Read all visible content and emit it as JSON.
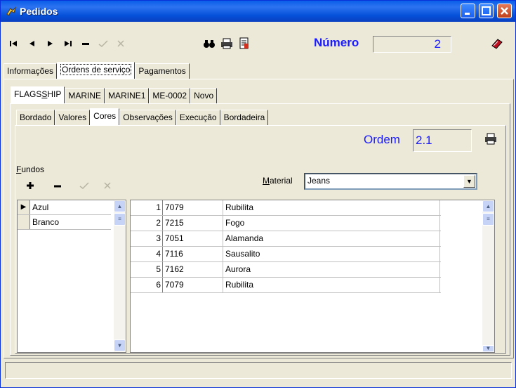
{
  "window": {
    "title": "Pedidos"
  },
  "toolbar": {
    "numero_label": "Número",
    "numero_value": "2"
  },
  "tabs_main": [
    "Informações",
    "Ordens de serviço",
    "Pagamentos"
  ],
  "tabs_orders": [
    "FLAGSSHIP",
    "MARINE",
    "MARINE1",
    "ME-0002",
    "Novo"
  ],
  "tabs_detail": [
    "Bordado",
    "Valores",
    "Cores",
    "Observações",
    "Execução",
    "Bordadeira"
  ],
  "ordem": {
    "label": "Ordem",
    "value": "2.1"
  },
  "fundos": {
    "label": "Fundos",
    "items": [
      "Azul",
      "Branco"
    ]
  },
  "material": {
    "label": "Material",
    "value": "Jeans"
  },
  "grid": {
    "rows": [
      {
        "n": "1",
        "code": "7079",
        "name": "Rubilita"
      },
      {
        "n": "2",
        "code": "7215",
        "name": "Fogo"
      },
      {
        "n": "3",
        "code": "7051",
        "name": "Alamanda"
      },
      {
        "n": "4",
        "code": "7116",
        "name": "Sausalito"
      },
      {
        "n": "5",
        "code": "7162",
        "name": "Aurora"
      },
      {
        "n": "6",
        "code": "7079",
        "name": "Rubilita"
      }
    ]
  }
}
